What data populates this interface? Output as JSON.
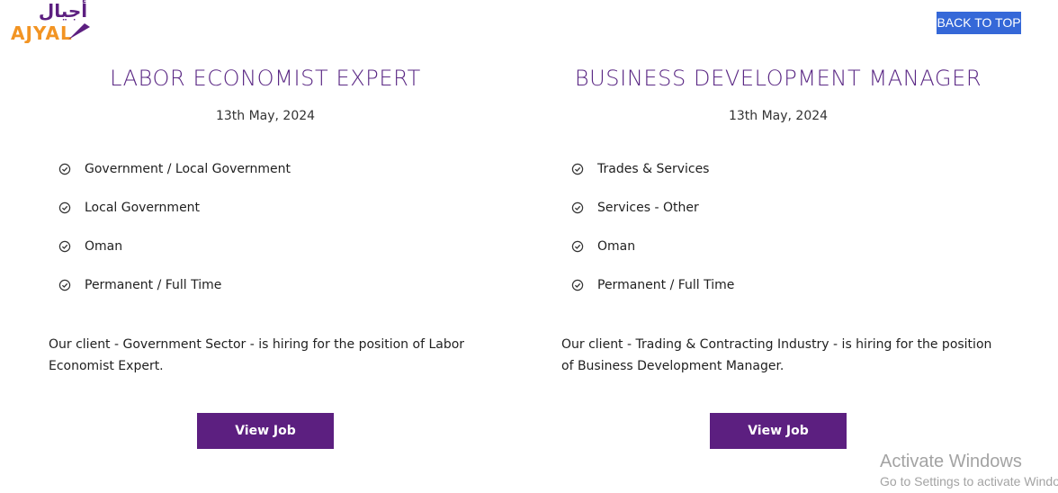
{
  "header": {
    "logo_alt_text": "أجيال",
    "logo_text": "AJYAL",
    "back_to_top_label": "BACK TO TOP"
  },
  "colors": {
    "brand_purple": "#5c1f80",
    "title_purple": "#5a2784",
    "logo_orange": "#f29423",
    "back_to_top_blue": "#3568d8"
  },
  "jobs": [
    {
      "title": "LABOR ECONOMIST EXPERT",
      "date": "13th May, 2024",
      "meta": [
        "Government / Local Government",
        "Local Government",
        "Oman",
        "Permanent / Full Time"
      ],
      "description": "Our client - Government Sector - is hiring for the position of Labor Economist Expert.",
      "button_label": "View Job"
    },
    {
      "title": "BUSINESS DEVELOPMENT MANAGER",
      "date": "13th May, 2024",
      "meta": [
        "Trades & Services",
        "Services - Other",
        "Oman",
        "Permanent / Full Time"
      ],
      "description": "Our client - Trading & Contracting Industry - is hiring for the position of Business Development Manager.",
      "button_label": "View Job"
    }
  ],
  "icons": {
    "meta_item": "check-circle-icon"
  },
  "watermark": {
    "title": "Activate Windows",
    "subtitle": "Go to Settings to activate Windows."
  }
}
